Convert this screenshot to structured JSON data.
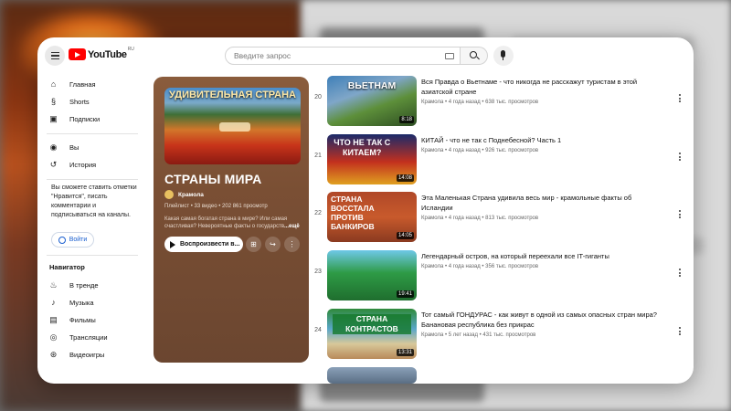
{
  "header": {
    "logo_text": "YouTube",
    "logo_country": "RU",
    "search_placeholder": "Введите запрос"
  },
  "sidebar": {
    "main": [
      {
        "label": "Главная",
        "icon": "home-icon"
      },
      {
        "label": "Shorts",
        "icon": "shorts-icon"
      },
      {
        "label": "Подписки",
        "icon": "subscriptions-icon"
      }
    ],
    "you": [
      {
        "label": "Вы",
        "icon": "you-icon"
      },
      {
        "label": "История",
        "icon": "history-icon"
      }
    ],
    "signin_prompt": "Вы сможете ставить отметки \"Нравится\", писать комментарии и подписываться на каналы.",
    "signin_label": "Войти",
    "navigator_title": "Навигатор",
    "navigator": [
      {
        "label": "В тренде",
        "icon": "trending-icon"
      },
      {
        "label": "Музыка",
        "icon": "music-icon"
      },
      {
        "label": "Фильмы",
        "icon": "movies-icon"
      },
      {
        "label": "Трансляции",
        "icon": "live-icon"
      },
      {
        "label": "Видеоигры",
        "icon": "gaming-icon"
      }
    ]
  },
  "playlist": {
    "thumbnail_caption": "УДИВИТЕЛЬНАЯ СТРАНА",
    "title": "СТРАНЫ МИРА",
    "author": "Крамола",
    "meta": "Плейлист • 33 видео • 202 861 просмотр",
    "description": "Какая самая богатая страна в мире? Или самая счастливая? Невероятные факты о государств",
    "more": "...ещё",
    "play_label": "Воспроизвести в...",
    "accent_color": "#7a4f34"
  },
  "videos": [
    {
      "index": "20",
      "title": "Вся Правда о Вьетнаме - что никогда не расскажут туристам в этой азиатской стране",
      "meta": "Крамола • 4 года назад • 638 тыс. просмотров",
      "duration": "8:18",
      "caption": "ВЬЕТНАМ"
    },
    {
      "index": "21",
      "title": "КИТАЙ - что не так с Поднебесной? Часть 1",
      "meta": "Крамола • 4 года назад • 926 тыс. просмотров",
      "duration": "14:08",
      "caption": "ЧТО НЕ ТАК С КИТАЕМ?"
    },
    {
      "index": "22",
      "title": "Эта Маленькая Страна удивила весь мир - крамольные факты об Исландии",
      "meta": "Крамола • 4 года назад • 813 тыс. просмотров",
      "duration": "14:05",
      "caption": "СТРАНА ВОССТАЛА ПРОТИВ БАНКИРОВ"
    },
    {
      "index": "23",
      "title": "Легендарный остров, на который переехали все IT-гиганты",
      "meta": "Крамола • 4 года назад • 356 тыс. просмотров",
      "duration": "19:41",
      "caption": ""
    },
    {
      "index": "24",
      "title": "Тот самый ГОНДУРАС - как живут в одной из самых опасных стран мира? Банановая республика без прикрас",
      "meta": "Крамола • 5 лет назад • 431 тыс. просмотров",
      "duration": "13:31",
      "caption": "СТРАНА КОНТРАСТОВ"
    }
  ]
}
